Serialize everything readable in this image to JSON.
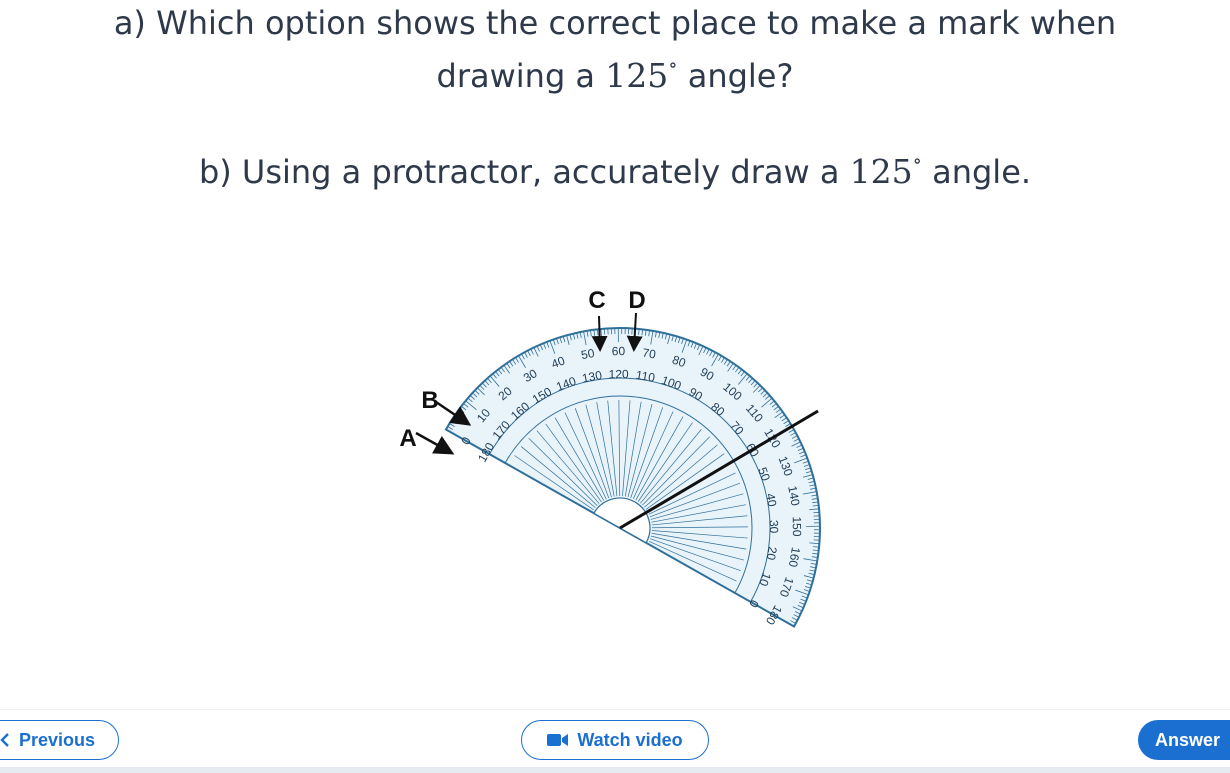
{
  "question": {
    "part_a": {
      "line1": "a) Which option shows the correct place to make a mark when",
      "line2_pre": "drawing a ",
      "angle": "125",
      "degree": "∘",
      "line2_post": " angle?"
    },
    "part_b": {
      "pre": "b) Using a protractor, accurately draw a ",
      "angle": "125",
      "degree": "∘",
      "post": " angle."
    }
  },
  "figure": {
    "labels": {
      "a": "A",
      "b": "B",
      "c": "C",
      "d": "D"
    },
    "outer_ticks": [
      "0",
      "10",
      "20",
      "30",
      "40",
      "50",
      "60",
      "70",
      "80",
      "90",
      "100",
      "110",
      "120",
      "130",
      "140",
      "150",
      "160",
      "170",
      "180"
    ],
    "inner_ticks": [
      "180",
      "170",
      "160",
      "150",
      "140",
      "130",
      "120",
      "110",
      "100",
      "90",
      "80",
      "70",
      "60",
      "50",
      "40",
      "30",
      "20",
      "10",
      "0"
    ],
    "colors": {
      "protractor_fill": "#e9f3fa",
      "protractor_stroke": "#2f6f9a",
      "tick_text": "#1f3d55",
      "arrow": "#111111"
    }
  },
  "footer": {
    "previous_label": "Previous",
    "watch_label": "Watch video",
    "answer_label": "Answer",
    "accent_color": "#1b6fd1"
  }
}
